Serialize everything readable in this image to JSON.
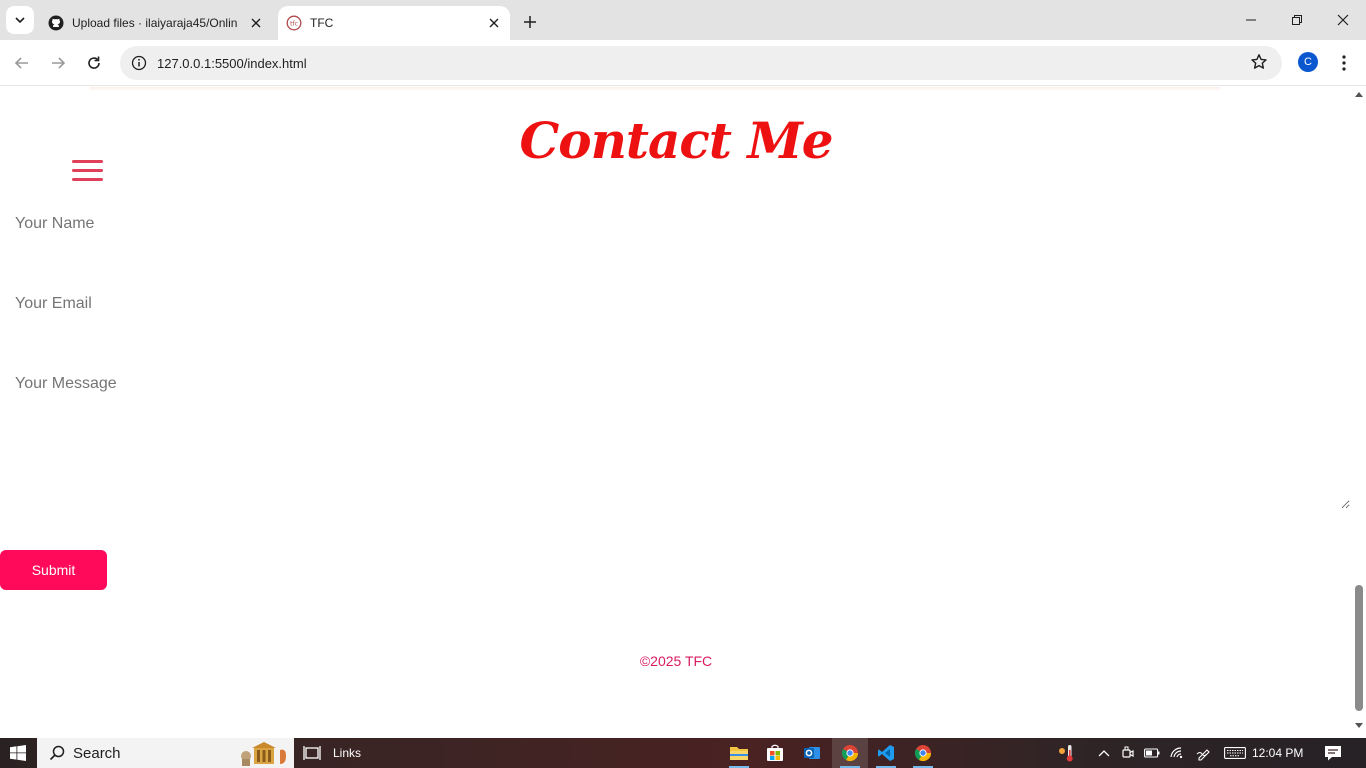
{
  "browser": {
    "tabs": [
      {
        "title": "Upload files · ilaiyaraja45/Onlin",
        "favicon": "github-icon",
        "active": false
      },
      {
        "title": "TFC",
        "favicon": "site-logo-icon",
        "active": true
      }
    ],
    "url": "127.0.0.1:5500/index.html",
    "profile_initial": "C"
  },
  "page": {
    "heading": "Contact Me",
    "form": {
      "name_placeholder": "Your Name",
      "email_placeholder": "Your Email",
      "message_placeholder": "Your Message",
      "submit_label": "Submit"
    },
    "footer": "©2025 TFC"
  },
  "taskbar": {
    "search_label": "Search",
    "links_label": "Links",
    "clock": "12:04 PM",
    "apps": [
      "file-explorer-icon",
      "store-icon",
      "outlook-icon",
      "chrome-icon",
      "vscode-icon",
      "chrome-alt-icon"
    ]
  },
  "colors": {
    "heading": "#ee1111",
    "accent": "#ff0a5a",
    "footer": "#d81b60",
    "hamburger": "#e0405a"
  }
}
